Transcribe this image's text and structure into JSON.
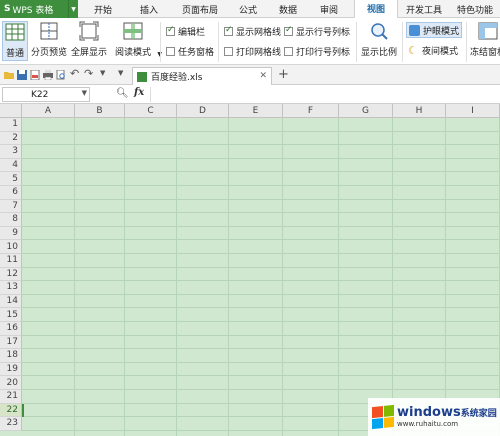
{
  "app": {
    "logo": "S",
    "name": "WPS 表格"
  },
  "tabs": [
    {
      "label": "开始"
    },
    {
      "label": "插入"
    },
    {
      "label": "页面布局"
    },
    {
      "label": "公式"
    },
    {
      "label": "数据"
    },
    {
      "label": "审阅"
    },
    {
      "label": "视图"
    },
    {
      "label": "开发工具"
    },
    {
      "label": "特色功能"
    }
  ],
  "active_tab": "视图",
  "ribbon": {
    "normal": "普通",
    "page_break": "分页预览",
    "full_screen": "全屏显示",
    "reading_mode": "阅读模式",
    "chk_edit_bar": "编辑栏",
    "chk_task_pane": "任务窗格",
    "chk_show_grid": "显示网格线",
    "chk_print_grid": "打印网格线",
    "chk_show_rowcol": "显示行号列标",
    "chk_print_rowcol": "打印行号列标",
    "zoom": "显示比例",
    "eye_mode": "护眼模式",
    "night_mode": "夜间模式",
    "freeze": "冻结窗格"
  },
  "document": {
    "tab_name": "百度经验.xls"
  },
  "formula_bar": {
    "cell_ref": "K22",
    "fx": "fx"
  },
  "sheet": {
    "columns": [
      "A",
      "B",
      "C",
      "D",
      "E",
      "F",
      "G",
      "H",
      "I"
    ],
    "rows": [
      "1",
      "2",
      "3",
      "4",
      "5",
      "6",
      "7",
      "8",
      "9",
      "10",
      "11",
      "12",
      "13",
      "14",
      "15",
      "16",
      "17",
      "18",
      "19",
      "20",
      "21",
      "22",
      "23"
    ],
    "active_row": "22",
    "fill_color": "#cfe8cf"
  },
  "watermark": {
    "brand": "windows",
    "brand_suffix": "系统家园",
    "url": "www.ruhaitu.com"
  }
}
